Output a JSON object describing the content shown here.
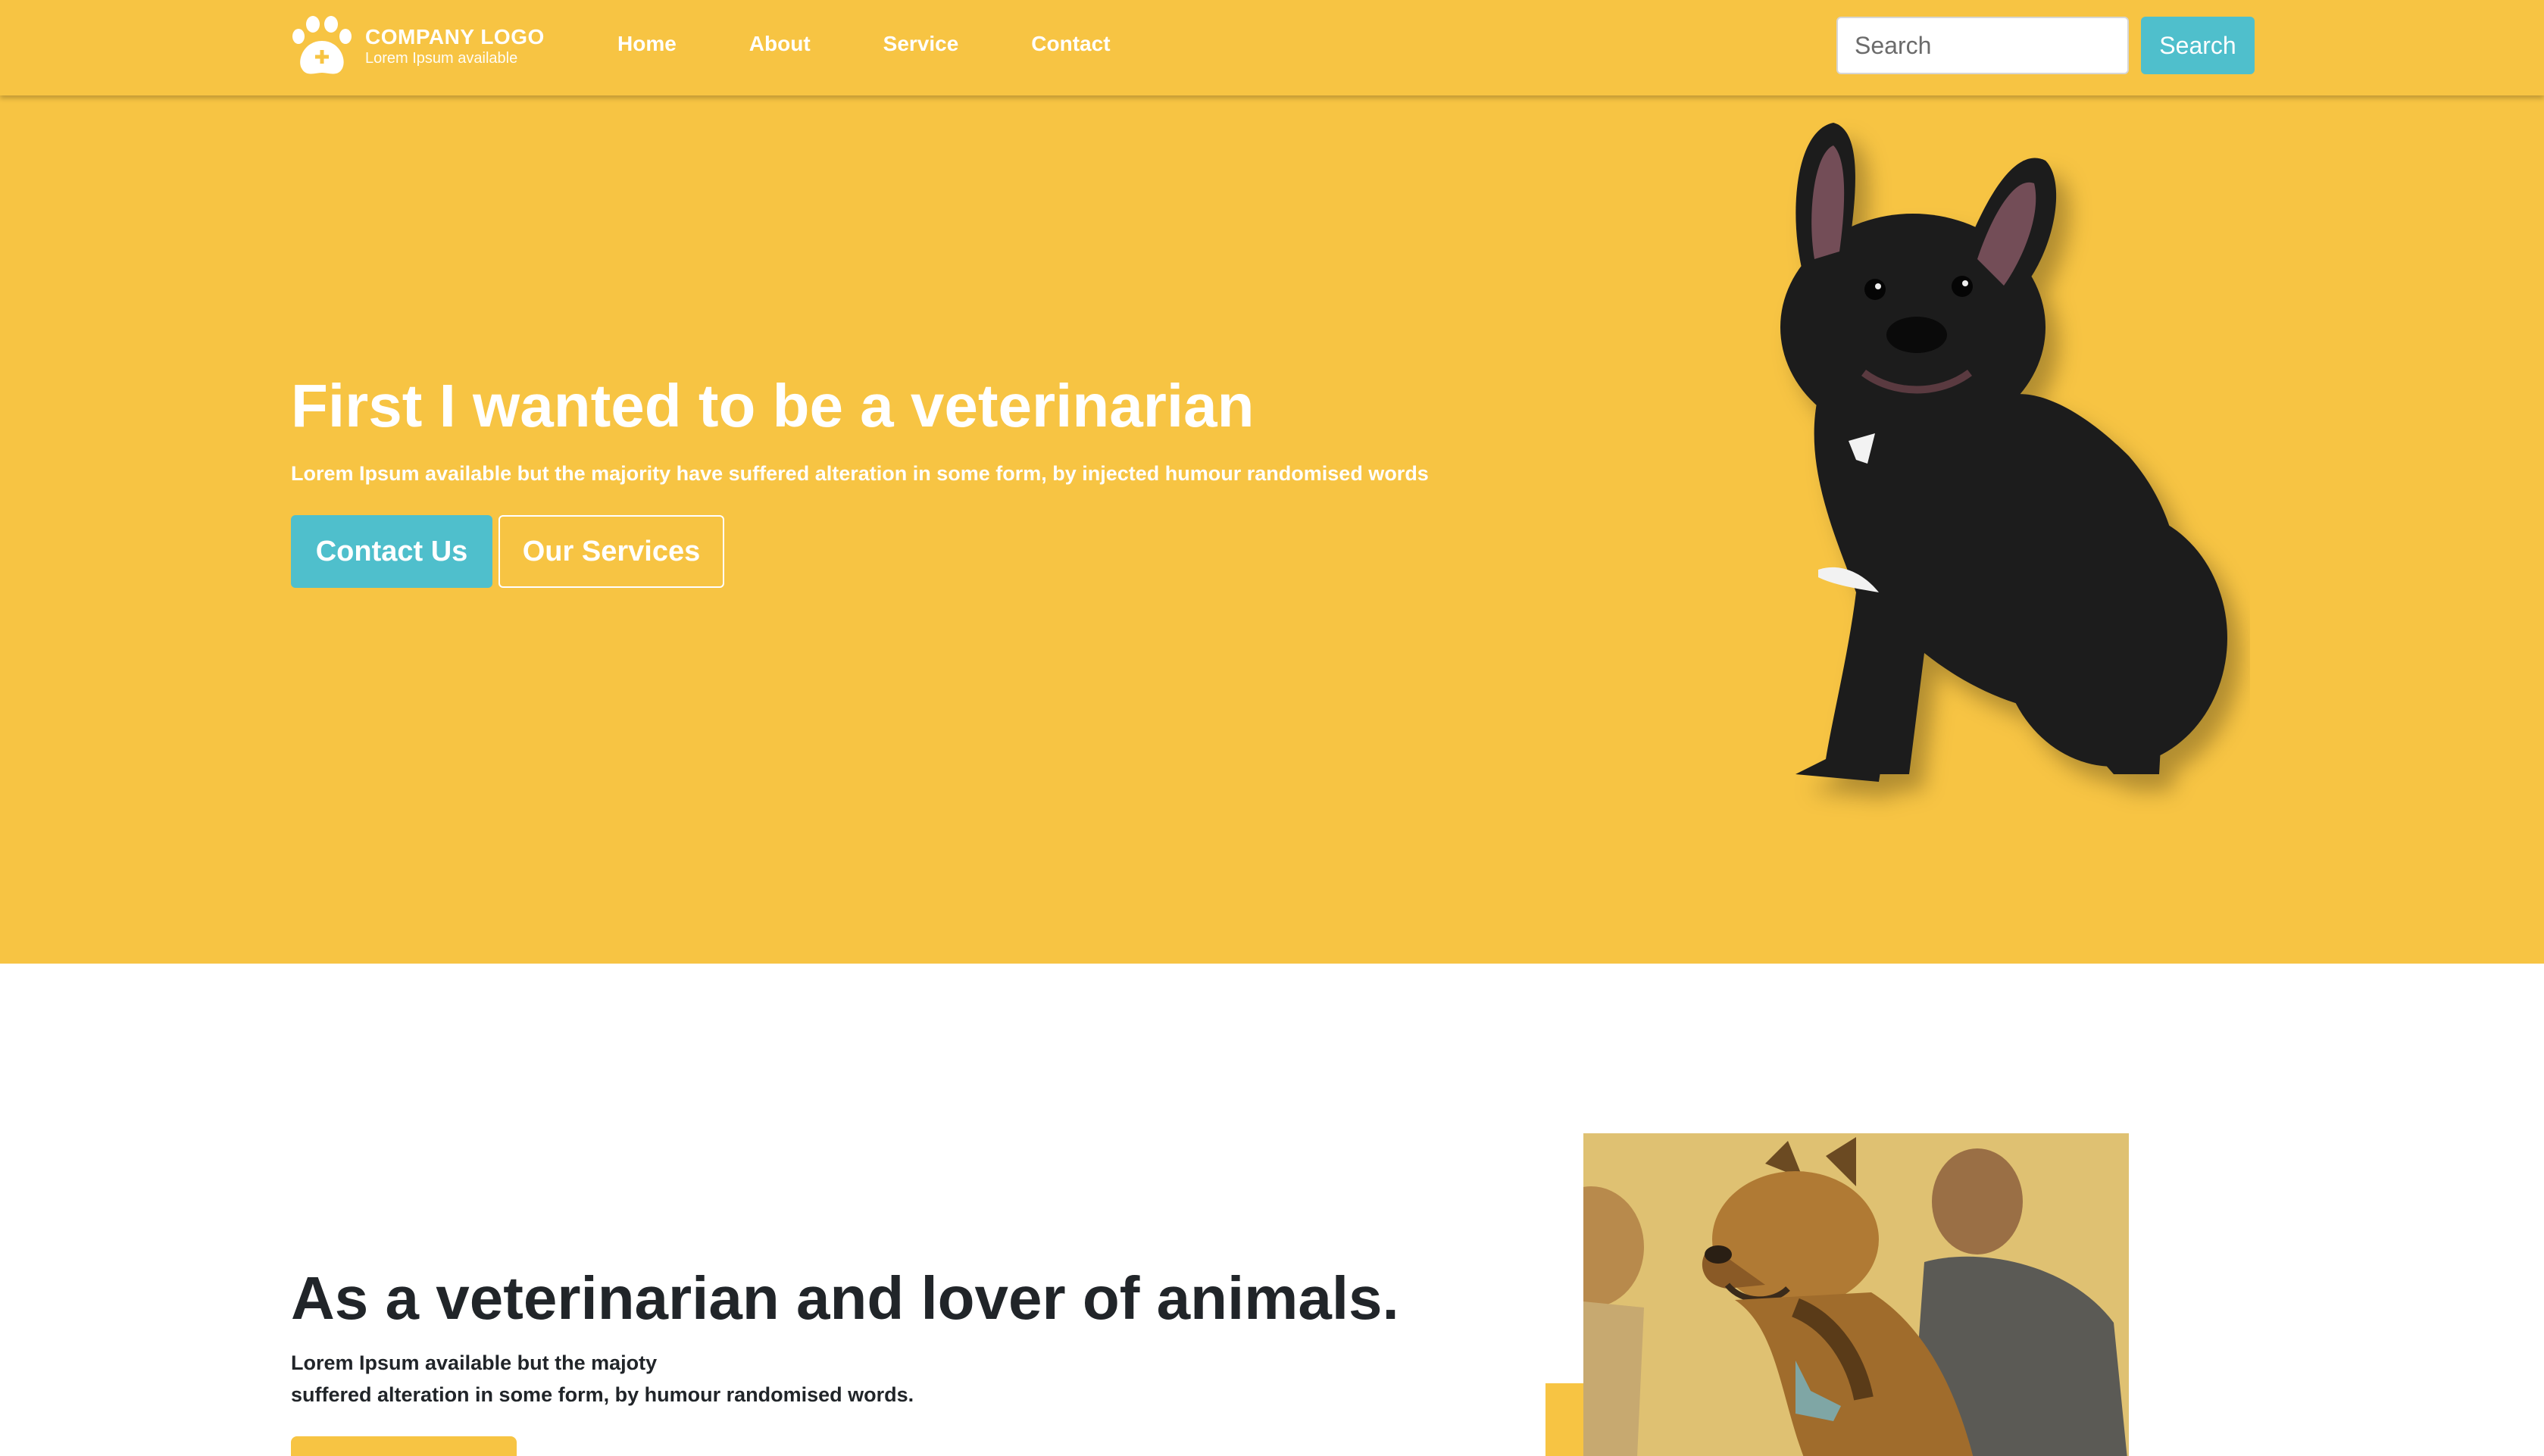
{
  "header": {
    "logo_title": "COMPANY LOGO",
    "logo_subtitle": "Lorem Ipsum available",
    "nav": [
      "Home",
      "About",
      "Service",
      "Contact"
    ],
    "search_placeholder": "Search",
    "search_button": "Search"
  },
  "hero": {
    "title": "First I wanted to be a veterinarian",
    "subtitle": "Lorem Ipsum available but the majority have suffered alteration in some form, by injected humour randomised words",
    "contact_button": "Contact Us",
    "services_button": "Our Services"
  },
  "about": {
    "title": "As a veterinarian and lover of animals.",
    "line1": "Lorem Ipsum available but the majoty",
    "line2": "suffered alteration in some form, by humour randomised words."
  },
  "colors": {
    "brand_yellow": "#f7c443",
    "accent_teal": "#4fbfcc",
    "text_dark": "#212529"
  },
  "icons": [
    "paw-logo-icon",
    "dog-image",
    "vet-dog-photo"
  ]
}
